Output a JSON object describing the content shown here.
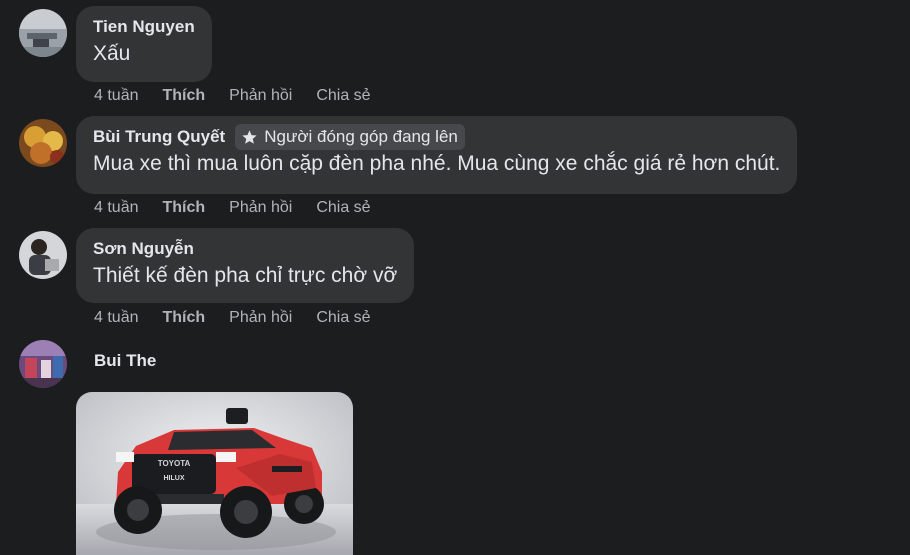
{
  "comments": [
    {
      "author": "Tien Nguyen",
      "text": "Xấu",
      "time": "4 tuần",
      "like": "Thích",
      "reply": "Phản hồi",
      "share": "Chia sẻ"
    },
    {
      "author": "Bùi Trung Quyết",
      "badge": "Người đóng góp đang lên",
      "text": "Mua xe thì mua luôn cặp đèn pha nhé. Mua cùng xe chắc giá rẻ hơn chút.",
      "time": "4 tuần",
      "like": "Thích",
      "reply": "Phản hồi",
      "share": "Chia sẻ"
    },
    {
      "author": "Sơn Nguyễn",
      "text": "Thiết kế đèn pha chỉ trực chờ vỡ",
      "time": "4 tuần",
      "like": "Thích",
      "reply": "Phản hồi",
      "share": "Chia sẻ"
    },
    {
      "author": "Bui The",
      "image": {
        "grille_text_1": "TOYOTA",
        "grille_text_2": "HILUX"
      }
    }
  ],
  "icons": {
    "badge": "star-icon"
  },
  "colors": {
    "background": "#1c1d1f",
    "bubble": "#333436",
    "badge": "#46484b",
    "text": "#e4e6eb",
    "muted": "#b0b3b8"
  }
}
